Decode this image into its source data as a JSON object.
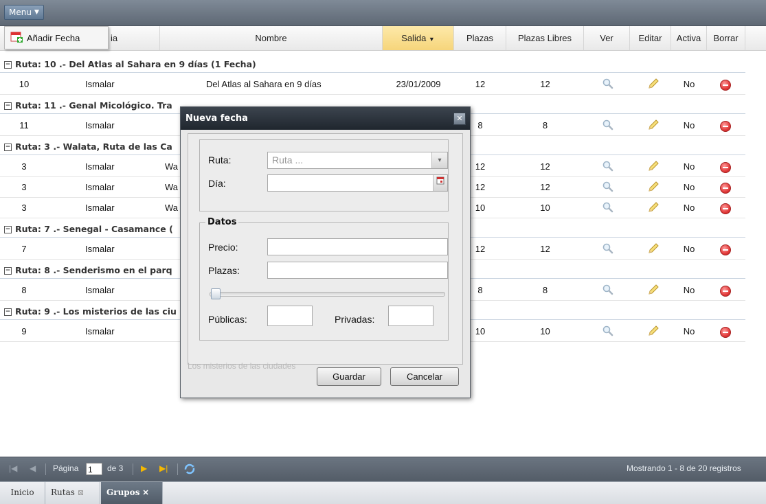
{
  "toolbar": {
    "menu_label": "Menu"
  },
  "menu_dropdown": {
    "item_label": "Añadir Fecha"
  },
  "columns": {
    "c1": "ia",
    "c2": "Nombre",
    "c3": "Salida",
    "c4": "Plazas",
    "c5": "Plazas Libres",
    "c6": "Ver",
    "c7": "Editar",
    "c8": "Activa",
    "c9": "Borrar"
  },
  "groups": [
    {
      "title": "Ruta: 10 .- Del Atlas al Sahara en 9 días (1 Fecha)",
      "rows": [
        {
          "id": "10",
          "agency": "Ismalar",
          "name": "Del Atlas al Sahara en 9 días",
          "date": "23/01/2009",
          "plazas": "12",
          "libres": "12",
          "activa": "No"
        }
      ]
    },
    {
      "title": "Ruta: 11 .- Genal Micológico. Tra",
      "rows": [
        {
          "id": "11",
          "agency": "Ismalar",
          "name": "",
          "date": "",
          "plazas": "8",
          "libres": "8",
          "activa": "No"
        }
      ]
    },
    {
      "title": "Ruta: 3 .- Walata, Ruta de las Ca",
      "rows": [
        {
          "id": "3",
          "agency": "Ismalar",
          "name": "Wa",
          "date": "",
          "plazas": "12",
          "libres": "12",
          "activa": "No"
        },
        {
          "id": "3",
          "agency": "Ismalar",
          "name": "Wa",
          "date": "",
          "plazas": "12",
          "libres": "12",
          "activa": "No"
        },
        {
          "id": "3",
          "agency": "Ismalar",
          "name": "Wa",
          "date": "",
          "plazas": "10",
          "libres": "10",
          "activa": "No"
        }
      ]
    },
    {
      "title": "Ruta: 7 .- Senegal - Casamance (",
      "rows": [
        {
          "id": "7",
          "agency": "Ismalar",
          "name": "",
          "date": "",
          "plazas": "12",
          "libres": "12",
          "activa": "No"
        }
      ]
    },
    {
      "title": "Ruta: 8 .- Senderismo en el parq",
      "rows": [
        {
          "id": "8",
          "agency": "Ismalar",
          "name": "",
          "date": "",
          "plazas": "8",
          "libres": "8",
          "activa": "No"
        }
      ]
    },
    {
      "title": "Ruta: 9 .- Los misterios de las ciu",
      "rows": [
        {
          "id": "9",
          "agency": "Ismalar",
          "name": "",
          "date": "",
          "plazas": "10",
          "libres": "10",
          "activa": "No"
        }
      ]
    }
  ],
  "dialog": {
    "title": "Nueva fecha",
    "ruta_label": "Ruta:",
    "ruta_placeholder": "Ruta ...",
    "dia_label": "Día:",
    "datos_legend": "Datos",
    "precio_label": "Precio:",
    "plazas_label": "Plazas:",
    "publicas_label": "Públicas:",
    "privadas_label": "Privadas:",
    "ghost_text": "Los misterios de las ciudades",
    "save_label": "Guardar",
    "cancel_label": "Cancelar"
  },
  "pager": {
    "page_label": "Página",
    "page_value": "1",
    "of_label": "de 3",
    "status": "Mostrando 1 - 8 de 20 registros"
  },
  "tabs": [
    {
      "label": "Inicio"
    },
    {
      "label": "Rutas"
    },
    {
      "label": "Grupos"
    }
  ],
  "colors": {
    "topbar": "#5e6874",
    "sort_header": "#f6d57b",
    "delete": "#e23b3b",
    "active_tab": "#505b67"
  }
}
